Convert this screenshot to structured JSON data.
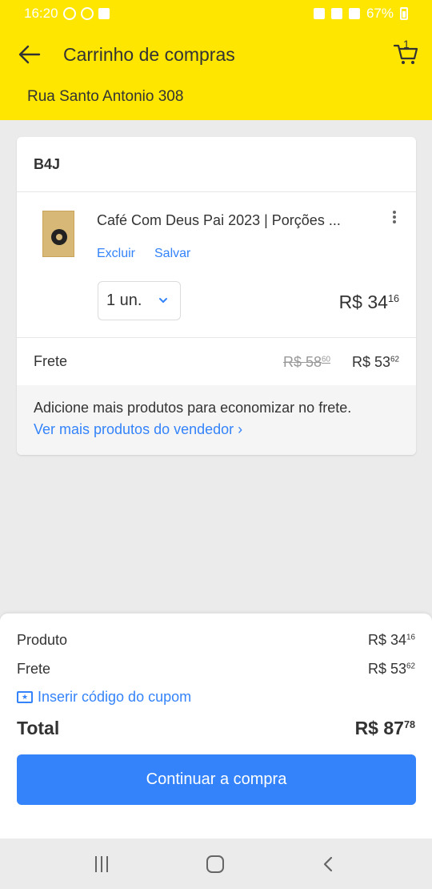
{
  "status_bar": {
    "time": "16:20",
    "battery": "67%"
  },
  "header": {
    "title": "Carrinho de compras",
    "cart_count": "1",
    "address": "Rua Santo Antonio 308"
  },
  "card": {
    "seller": "B4J",
    "product": {
      "title": "Café Com Deus Pai 2023 | Porções ...",
      "delete_label": "Excluir",
      "save_label": "Salvar",
      "quantity": "1 un.",
      "price_main": "R$ 34",
      "price_cents": "16"
    },
    "shipping": {
      "label": "Frete",
      "old_main": "R$ 58",
      "old_cents": "60",
      "new_main": "R$ 53",
      "new_cents": "62"
    },
    "promo": {
      "text": "Adicione mais produtos para economizar no frete.",
      "link": "Ver mais produtos do vendedor ›"
    }
  },
  "summary": {
    "product_label": "Produto",
    "product_main": "R$ 34",
    "product_cents": "16",
    "shipping_label": "Frete",
    "shipping_main": "R$ 53",
    "shipping_cents": "62",
    "coupon_label": "Inserir código do cupom",
    "total_label": "Total",
    "total_main": "R$ 87",
    "total_cents": "78",
    "continue_label": "Continuar a compra"
  },
  "colors": {
    "header_yellow": "#ffe600",
    "accent_blue": "#3483fa"
  },
  "icons": [
    "back-arrow-icon",
    "cart-icon",
    "more-vertical-icon",
    "chevron-down-icon",
    "coupon-icon",
    "recent-apps-icon",
    "home-icon",
    "nav-back-icon"
  ]
}
